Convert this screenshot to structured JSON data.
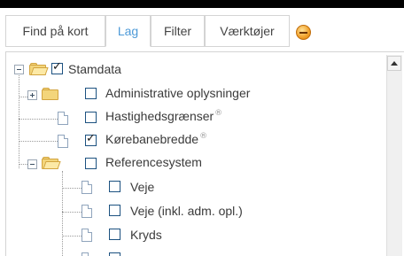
{
  "tabs": [
    {
      "label": "Find på kort",
      "active": false
    },
    {
      "label": "Lag",
      "active": true
    },
    {
      "label": "Filter",
      "active": false
    },
    {
      "label": "Værktøjer",
      "active": false
    }
  ],
  "collapse_icon": "collapse-minus-icon",
  "accent_color": "#4d9ad8",
  "tree": {
    "root": {
      "label": "Stamdata",
      "checked": true,
      "expanded": true
    },
    "items": [
      {
        "label": "Administrative oplysninger",
        "checked": false,
        "type": "folder",
        "expanded": false
      },
      {
        "label": "Hastighedsgrænser",
        "checked": false,
        "type": "layer",
        "info": "®"
      },
      {
        "label": "Kørebanebredde",
        "checked": true,
        "type": "layer",
        "info": "®"
      },
      {
        "label": "Referencesystem",
        "checked": false,
        "type": "folder",
        "expanded": true
      },
      {
        "label": "Veje",
        "checked": false,
        "type": "layer"
      },
      {
        "label": "Veje (inkl. adm. opl.)",
        "checked": false,
        "type": "layer"
      },
      {
        "label": "Kryds",
        "checked": false,
        "type": "layer"
      }
    ]
  }
}
